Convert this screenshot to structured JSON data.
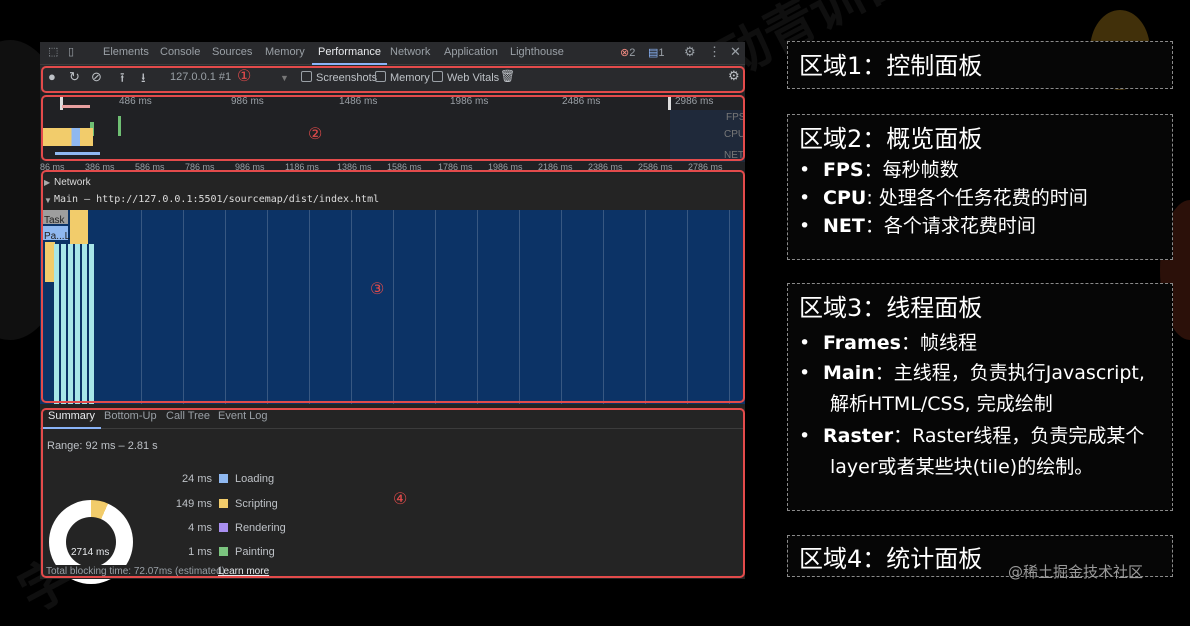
{
  "devtools": {
    "tabs": [
      "Elements",
      "Console",
      "Sources",
      "Memory",
      "Performance",
      "Network",
      "Application",
      "Lighthouse"
    ],
    "active_tab": "Performance",
    "errors_count": "2",
    "messages_count": "1",
    "toolbar": {
      "profile_select": "127.0.0.1 #1",
      "screenshots_label": "Screenshots",
      "memory_label": "Memory",
      "web_vitals_label": "Web Vitals"
    },
    "overview": {
      "ticks": [
        "486 ms",
        "986 ms",
        "1486 ms",
        "1986 ms",
        "2486 ms",
        "2986 ms"
      ],
      "lane_labels": [
        "FPS",
        "CPU",
        "NET"
      ]
    },
    "ruler_ticks": [
      "86 ms",
      "386 ms",
      "586 ms",
      "786 ms",
      "986 ms",
      "1186 ms",
      "1386 ms",
      "1586 ms",
      "1786 ms",
      "1986 ms",
      "2186 ms",
      "2386 ms",
      "2586 ms",
      "2786 ms"
    ],
    "flame": {
      "network_label": "Network",
      "main_label": "Main — http://127.0.0.1:5501/sourcemap/dist/index.html",
      "task_label": "Task",
      "pa_label": "Pa...L"
    },
    "summary": {
      "tabs": [
        "Summary",
        "Bottom-Up",
        "Call Tree",
        "Event Log"
      ],
      "range": "Range: 92 ms – 2.81 s",
      "items": [
        {
          "value": "24 ms",
          "label": "Loading",
          "color": "#8fb8f0"
        },
        {
          "value": "149 ms",
          "label": "Scripting",
          "color": "#f2cc6b"
        },
        {
          "value": "4 ms",
          "label": "Rendering",
          "color": "#a98ff0"
        },
        {
          "value": "1 ms",
          "label": "Painting",
          "color": "#7bc47f"
        }
      ],
      "total": "2714 ms",
      "footer_text": "Total blocking time: 72.07ms (estimated)",
      "learn_more": "Learn more"
    },
    "region_numbers": [
      "①",
      "②",
      "③",
      "④"
    ]
  },
  "panels": [
    {
      "title": "区域1：控制面板",
      "bullets": []
    },
    {
      "title": "区域2：概览面板",
      "bullets": [
        {
          "key": "FPS",
          "text": "：每秒帧数"
        },
        {
          "key": "CPU",
          "text": ": 处理各个任务花费的时间"
        },
        {
          "key": "NET",
          "text": "：各个请求花费时间"
        }
      ]
    },
    {
      "title": "区域3：线程面板",
      "bullets": [
        {
          "key": "Frames",
          "text": "：帧线程"
        },
        {
          "key": "Main",
          "text": "：主线程，负责执行Javascript,",
          "cont": "解析HTML/CSS, 完成绘制"
        },
        {
          "key": "Raster",
          "text": "：Raster线程，负责完成某个",
          "cont": "layer或者某些块(tile)的绘制。"
        }
      ]
    },
    {
      "title": "区域4：统计面板",
      "bullets": []
    }
  ],
  "credit": "@稀土掘金技术社区",
  "watermark": "字节跳动青训营",
  "colors": {
    "accent_red": "#e34b4b",
    "flame_blue": "#0c3366"
  }
}
